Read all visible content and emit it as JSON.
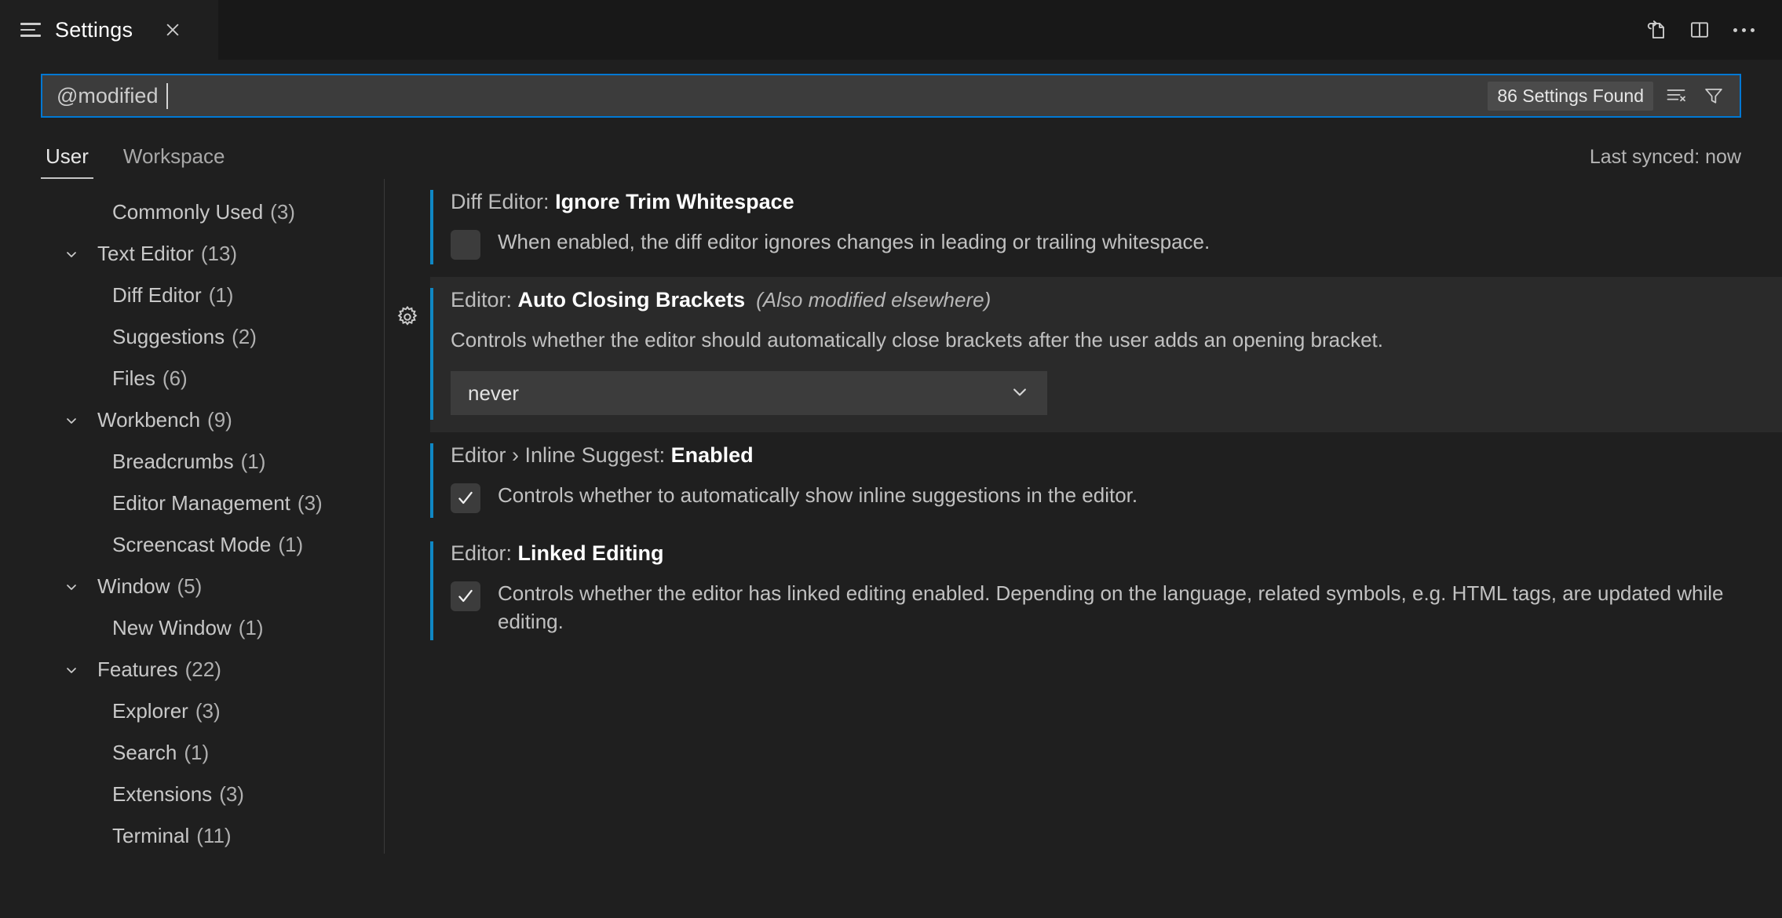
{
  "window": {
    "tab": {
      "title": "Settings",
      "icon": "settings-list-icon",
      "close_icon": "close-icon"
    },
    "actions": [
      {
        "name": "open-settings-json-button",
        "icon": "file-with-arrow-icon",
        "label": "Open Settings (JSON)"
      },
      {
        "name": "split-editor-button",
        "icon": "split-editor-icon",
        "label": "Split Editor"
      },
      {
        "name": "more-actions-button",
        "icon": "ellipsis-icon",
        "label": "More Actions..."
      }
    ]
  },
  "search": {
    "value": "@modified ",
    "placeholder": "Search settings",
    "results_label": "86 Settings Found",
    "clear_filters_icon": "clear-settings-search-icon",
    "filter_icon": "funnel-filter-icon"
  },
  "scope": {
    "tabs": [
      {
        "label": "User",
        "active": true
      },
      {
        "label": "Workspace",
        "active": false
      }
    ],
    "sync_status": "Last synced: now"
  },
  "toc": {
    "items": [
      {
        "label": "Commonly Used",
        "count": "(3)",
        "level": "child",
        "expandable": false
      },
      {
        "label": "Text Editor",
        "count": "(13)",
        "level": "group",
        "expandable": true,
        "expanded": true
      },
      {
        "label": "Diff Editor",
        "count": "(1)",
        "level": "child",
        "expandable": false
      },
      {
        "label": "Suggestions",
        "count": "(2)",
        "level": "child",
        "expandable": false
      },
      {
        "label": "Files",
        "count": "(6)",
        "level": "child",
        "expandable": false
      },
      {
        "label": "Workbench",
        "count": "(9)",
        "level": "group",
        "expandable": true,
        "expanded": true
      },
      {
        "label": "Breadcrumbs",
        "count": "(1)",
        "level": "child",
        "expandable": false
      },
      {
        "label": "Editor Management",
        "count": "(3)",
        "level": "child",
        "expandable": false
      },
      {
        "label": "Screencast Mode",
        "count": "(1)",
        "level": "child",
        "expandable": false
      },
      {
        "label": "Window",
        "count": "(5)",
        "level": "group",
        "expandable": true,
        "expanded": true
      },
      {
        "label": "New Window",
        "count": "(1)",
        "level": "child",
        "expandable": false
      },
      {
        "label": "Features",
        "count": "(22)",
        "level": "group",
        "expandable": true,
        "expanded": true
      },
      {
        "label": "Explorer",
        "count": "(3)",
        "level": "child",
        "expandable": false
      },
      {
        "label": "Search",
        "count": "(1)",
        "level": "child",
        "expandable": false
      },
      {
        "label": "Extensions",
        "count": "(3)",
        "level": "child",
        "expandable": false
      },
      {
        "label": "Terminal",
        "count": "(11)",
        "level": "child",
        "expandable": false
      }
    ]
  },
  "settings": [
    {
      "category": "Diff Editor: ",
      "name": "Ignore Trim Whitespace",
      "note": "",
      "description": "When enabled, the diff editor ignores changes in leading or trailing whitespace.",
      "control": "checkbox",
      "checked": false,
      "modified": true,
      "hovered": false,
      "gear": false
    },
    {
      "category": "Editor: ",
      "name": "Auto Closing Brackets",
      "note": "(Also modified elsewhere)",
      "description": "Controls whether the editor should automatically close brackets after the user adds an opening bracket.",
      "control": "dropdown",
      "value": "never",
      "modified": true,
      "hovered": true,
      "gear": true
    },
    {
      "category": "Editor › Inline Suggest: ",
      "name": "Enabled",
      "note": "",
      "description": "Controls whether to automatically show inline suggestions in the editor.",
      "control": "checkbox",
      "checked": true,
      "modified": true,
      "hovered": false,
      "gear": false
    },
    {
      "category": "Editor: ",
      "name": "Linked Editing",
      "note": "",
      "description": "Controls whether the editor has linked editing enabled. Depending on the language, related symbols, e.g. HTML tags, are updated while editing.",
      "control": "checkbox",
      "checked": true,
      "modified": true,
      "hovered": false,
      "gear": false
    }
  ],
  "colors": {
    "background": "#1f1f1f",
    "tabbar_background": "#181818",
    "accent_focus_border": "#0078d4",
    "modified_indicator": "#0f87c4",
    "input_background": "#3c3c3c",
    "hover_row": "#2a2a2a",
    "text": "#cccccc"
  }
}
